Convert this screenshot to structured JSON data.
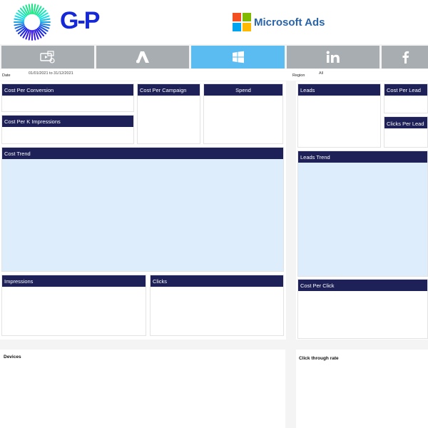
{
  "header": {
    "brand_text": "G-P",
    "platform_label": "Microsoft Ads",
    "ms_colors": [
      "#f25022",
      "#7fba00",
      "#00a4ef",
      "#ffb900"
    ]
  },
  "tabs": [
    {
      "icon": "video-ads-icon",
      "active": false
    },
    {
      "icon": "google-ads-icon",
      "active": false
    },
    {
      "icon": "windows-icon",
      "active": true
    },
    {
      "icon": "linkedin-icon",
      "active": false
    },
    {
      "icon": "facebook-icon",
      "active": false
    }
  ],
  "filters": {
    "date_label": "Date",
    "date_value": "01/01/2021 to 31/12/2021",
    "region_label": "Region",
    "region_value": "All"
  },
  "panels": {
    "cost_per_conversion": "Cost Per Conversion",
    "cost_per_campaign": "Cost Per Campaign",
    "spend": "Spend",
    "cost_per_k_impressions": "Cost Per K Impressions",
    "cost_trend": "Cost Trend",
    "impressions": "Impressions",
    "clicks": "Clicks",
    "leads": "Leads",
    "cost_per_lead": "Cost Per Lead",
    "clicks_per_lead": "Clicks Per Lead",
    "leads_trend": "Leads Trend",
    "cost_per_click": "Cost Per Click",
    "devices": "Devices",
    "click_through_rate": "Click through rate"
  },
  "colors": {
    "panel_header": "#1e2157",
    "active_tab": "#5bbcf2",
    "inactive_tab": "#a8adb2",
    "chart_fill": "#deedfc",
    "brand_blue": "#1428d8"
  }
}
